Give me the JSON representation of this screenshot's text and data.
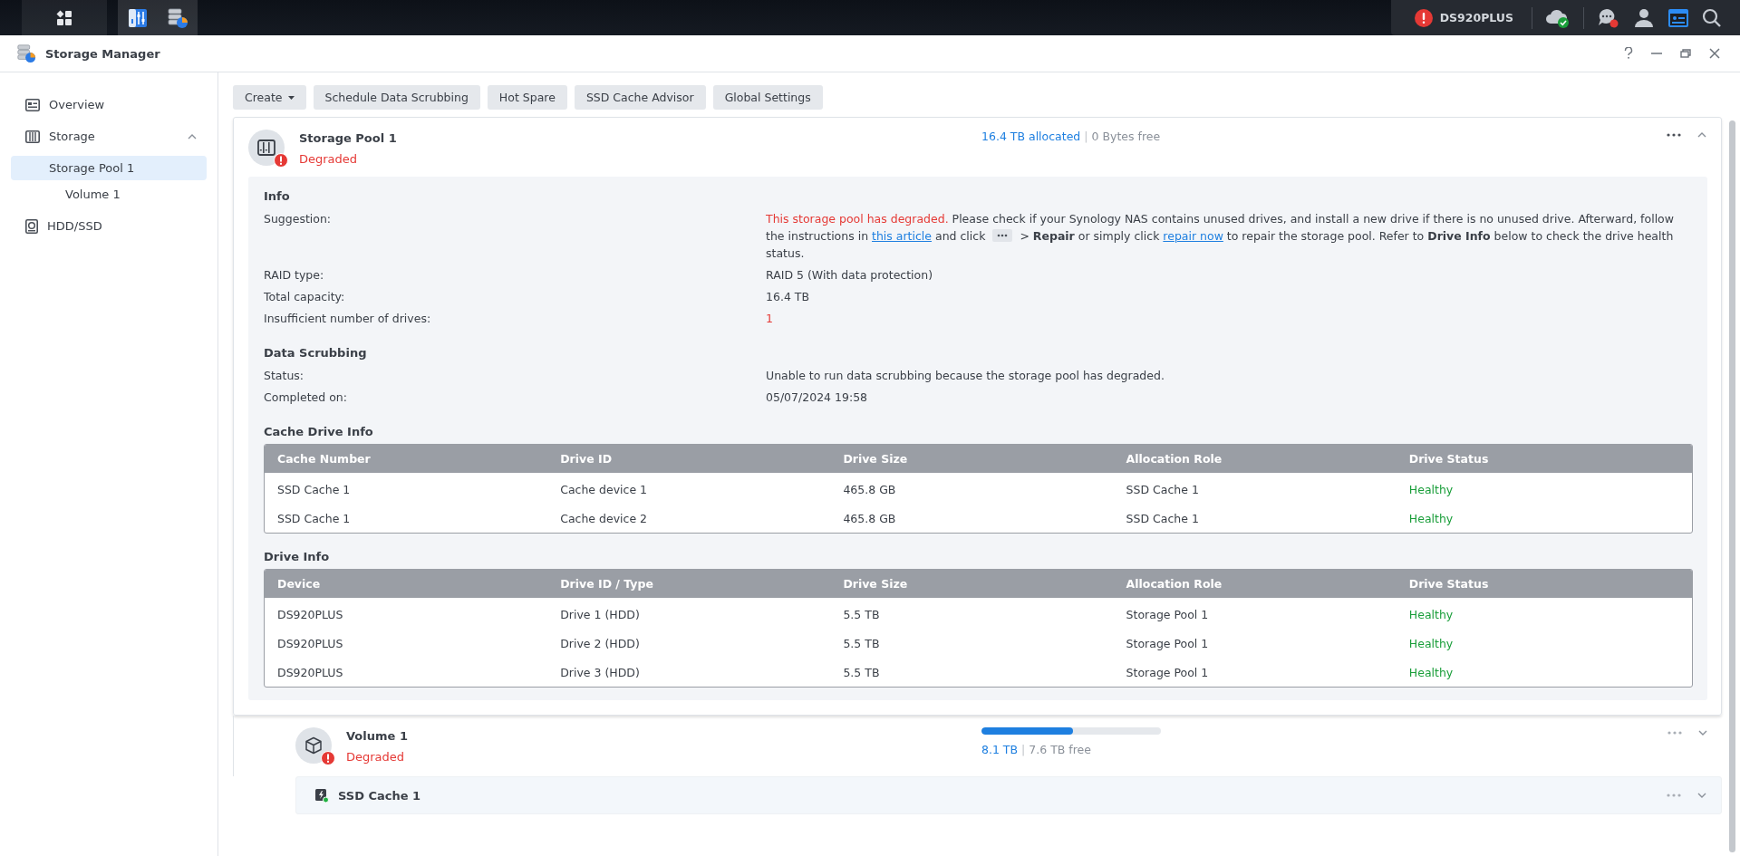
{
  "taskbar": {
    "device_name": "DS920PLUS"
  },
  "window": {
    "title": "Storage Manager"
  },
  "sidebar": {
    "items": [
      {
        "kind": "overview",
        "label": "Overview",
        "selected": false
      },
      {
        "kind": "storage",
        "label": "Storage",
        "selected": false,
        "expanded": true,
        "children": [
          {
            "label": "Storage Pool 1",
            "selected": true,
            "children": [
              {
                "label": "Volume 1",
                "selected": false
              }
            ]
          }
        ]
      },
      {
        "kind": "disk",
        "label": "HDD/SSD",
        "selected": false
      }
    ]
  },
  "toolbar": {
    "buttons": [
      {
        "label": "Create",
        "dropdown": true
      },
      {
        "label": "Schedule Data Scrubbing",
        "dropdown": false
      },
      {
        "label": "Hot Spare",
        "dropdown": false
      },
      {
        "label": "SSD Cache Advisor",
        "dropdown": false
      },
      {
        "label": "Global Settings",
        "dropdown": false
      }
    ]
  },
  "storage_pool": {
    "name": "Storage Pool 1",
    "status": "Degraded",
    "alert": true,
    "expanded": true,
    "allocated": "16.4 TB allocated",
    "separator": "|",
    "free": "0 Bytes free",
    "info": {
      "title": "Info",
      "suggestion_label": "Suggestion:",
      "suggestion": [
        {
          "kind": "warning",
          "text": "This storage pool has degraded."
        },
        {
          "kind": "text",
          "text": " Please check if your Synology NAS contains unused drives, and install a new drive if there is no unused drive. Afterward, follow the instructions in "
        },
        {
          "kind": "link",
          "text": "this article"
        },
        {
          "kind": "text",
          "text": " and click "
        },
        {
          "kind": "menu-chip"
        },
        {
          "kind": "text",
          "text": " > "
        },
        {
          "kind": "bold",
          "text": "Repair"
        },
        {
          "kind": "text",
          "text": " or simply click "
        },
        {
          "kind": "link",
          "text": "repair now"
        },
        {
          "kind": "text",
          "text": " to repair the storage pool. Refer to "
        },
        {
          "kind": "bold",
          "text": "Drive Info"
        },
        {
          "kind": "text",
          "text": " below to check the drive health status."
        }
      ],
      "rows": [
        {
          "label": "RAID type:",
          "value": "RAID 5 (With data protection)",
          "alert": false
        },
        {
          "label": "Total capacity:",
          "value": "16.4 TB",
          "alert": false
        },
        {
          "label": "Insufficient number of drives:",
          "value": "1",
          "alert": true
        }
      ]
    },
    "data_scrubbing": {
      "title": "Data Scrubbing",
      "rows": [
        {
          "label": "Status:",
          "value": "Unable to run data scrubbing because the storage pool has degraded.",
          "alert": false
        },
        {
          "label": "Completed on:",
          "value": "05/07/2024 19:58",
          "alert": false
        }
      ]
    },
    "cache_drive_info": {
      "title": "Cache Drive Info",
      "columns": [
        "Cache Number",
        "Drive ID",
        "Drive Size",
        "Allocation Role",
        "Drive Status"
      ],
      "rows": [
        {
          "cells": [
            "SSD Cache 1",
            "Cache device 1",
            "465.8 GB",
            "SSD Cache 1",
            "Healthy"
          ],
          "healthy": true
        },
        {
          "cells": [
            "SSD Cache 1",
            "Cache device 2",
            "465.8 GB",
            "SSD Cache 1",
            "Healthy"
          ],
          "healthy": true
        }
      ]
    },
    "drive_info": {
      "title": "Drive Info",
      "columns": [
        "Device",
        "Drive ID / Type",
        "Drive Size",
        "Allocation Role",
        "Drive Status"
      ],
      "rows": [
        {
          "cells": [
            "DS920PLUS",
            "Drive 1 (HDD)",
            "5.5 TB",
            "Storage Pool 1",
            "Healthy"
          ],
          "healthy": true
        },
        {
          "cells": [
            "DS920PLUS",
            "Drive 2 (HDD)",
            "5.5 TB",
            "Storage Pool 1",
            "Healthy"
          ],
          "healthy": true
        },
        {
          "cells": [
            "DS920PLUS",
            "Drive 3 (HDD)",
            "5.5 TB",
            "Storage Pool 1",
            "Healthy"
          ],
          "healthy": true
        }
      ]
    }
  },
  "volume": {
    "name": "Volume 1",
    "status": "Degraded",
    "alert": true,
    "expanded": false,
    "level": 0.51,
    "used": "8.1 TB",
    "separator": "|",
    "free": "7.6 TB free"
  },
  "ssd_cache": {
    "name": "SSD Cache 1",
    "expanded": false
  }
}
